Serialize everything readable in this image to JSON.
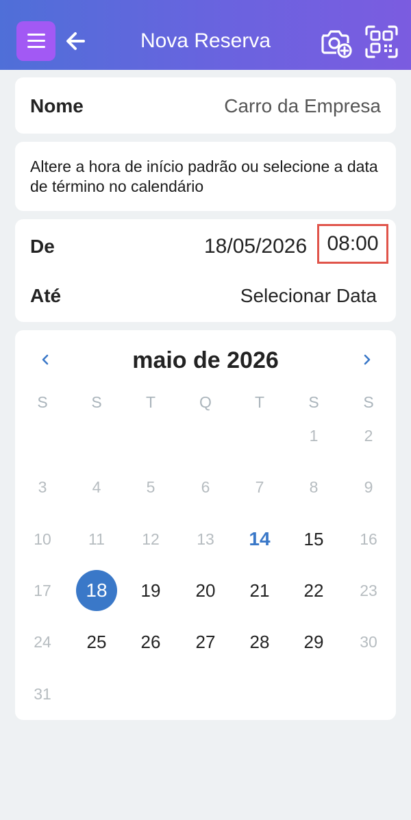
{
  "header": {
    "title": "Nova Reserva",
    "icons": [
      "menu-icon",
      "back-arrow-icon",
      "camera-add-icon",
      "qr-scan-icon"
    ],
    "colors": {
      "gradient_start": "#4f6fd8",
      "gradient_end": "#7b5ce0",
      "menu_button": "#a259f4"
    }
  },
  "name_card": {
    "label": "Nome",
    "value": "Carro da Empresa"
  },
  "info_card": {
    "text": "Altere a hora de início padrão ou selecione a data de término no calendário"
  },
  "dates_card": {
    "from_label": "De",
    "from_date": "18/05/2026",
    "from_time": "08:00",
    "to_label": "Até",
    "to_value": "Selecionar Data",
    "highlight_color": "#e0544a"
  },
  "calendar": {
    "month_title": "maio de 2026",
    "weekdays": [
      "S",
      "S",
      "T",
      "Q",
      "T",
      "S",
      "S"
    ],
    "today": "14",
    "selected": "18",
    "accent_color": "#3a78c8",
    "weeks": [
      [
        {
          "d": "",
          "s": "empty"
        },
        {
          "d": "",
          "s": "empty"
        },
        {
          "d": "",
          "s": "empty"
        },
        {
          "d": "",
          "s": "empty"
        },
        {
          "d": "",
          "s": "empty"
        },
        {
          "d": "1",
          "s": "muted"
        },
        {
          "d": "2",
          "s": "muted"
        }
      ],
      [
        {
          "d": "3",
          "s": "muted"
        },
        {
          "d": "4",
          "s": "muted"
        },
        {
          "d": "5",
          "s": "muted"
        },
        {
          "d": "6",
          "s": "muted"
        },
        {
          "d": "7",
          "s": "muted"
        },
        {
          "d": "8",
          "s": "muted"
        },
        {
          "d": "9",
          "s": "muted"
        }
      ],
      [
        {
          "d": "10",
          "s": "muted"
        },
        {
          "d": "11",
          "s": "muted"
        },
        {
          "d": "12",
          "s": "muted"
        },
        {
          "d": "13",
          "s": "muted"
        },
        {
          "d": "14",
          "s": "today"
        },
        {
          "d": "15",
          "s": "active"
        },
        {
          "d": "16",
          "s": "muted"
        }
      ],
      [
        {
          "d": "17",
          "s": "muted"
        },
        {
          "d": "18",
          "s": "selected"
        },
        {
          "d": "19",
          "s": "active"
        },
        {
          "d": "20",
          "s": "active"
        },
        {
          "d": "21",
          "s": "active"
        },
        {
          "d": "22",
          "s": "active"
        },
        {
          "d": "23",
          "s": "muted"
        }
      ],
      [
        {
          "d": "24",
          "s": "muted"
        },
        {
          "d": "25",
          "s": "active"
        },
        {
          "d": "26",
          "s": "active"
        },
        {
          "d": "27",
          "s": "active"
        },
        {
          "d": "28",
          "s": "active"
        },
        {
          "d": "29",
          "s": "active"
        },
        {
          "d": "30",
          "s": "muted"
        }
      ],
      [
        {
          "d": "31",
          "s": "muted"
        },
        {
          "d": "",
          "s": "empty"
        },
        {
          "d": "",
          "s": "empty"
        },
        {
          "d": "",
          "s": "empty"
        },
        {
          "d": "",
          "s": "empty"
        },
        {
          "d": "",
          "s": "empty"
        },
        {
          "d": "",
          "s": "empty"
        }
      ]
    ]
  }
}
